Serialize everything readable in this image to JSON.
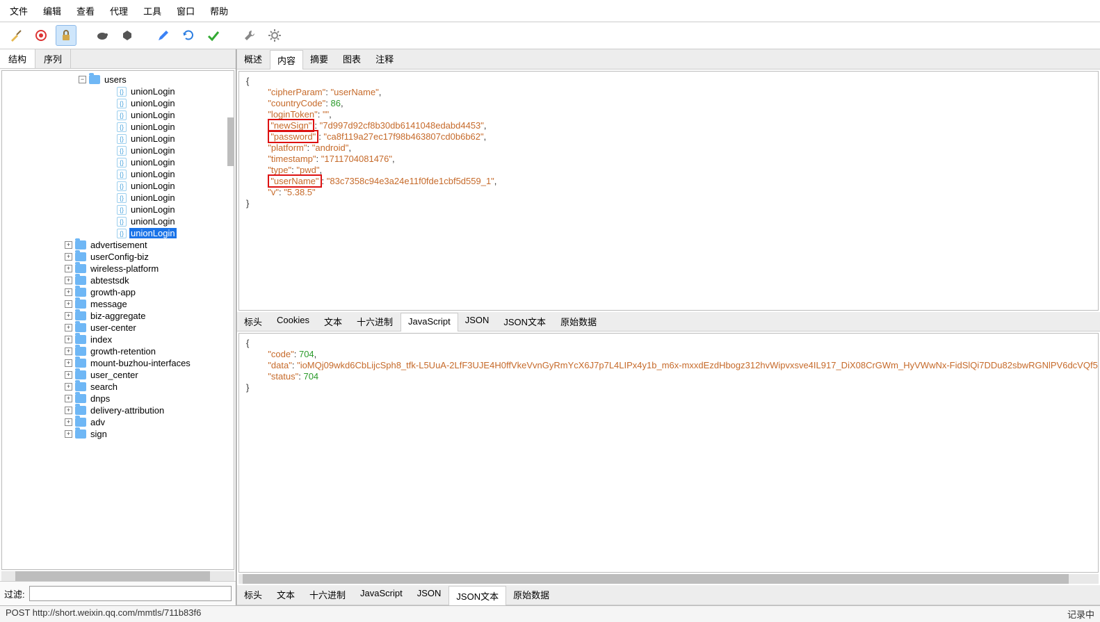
{
  "menu": {
    "items": [
      "文件",
      "编辑",
      "查看",
      "代理",
      "工具",
      "窗口",
      "帮助"
    ]
  },
  "toolbar": {
    "icons": [
      "broom",
      "record",
      "lock",
      "turtle-dark",
      "hex",
      "pen",
      "refresh",
      "check",
      "wrench",
      "gear"
    ],
    "selected_index": 2
  },
  "left_tabs": {
    "items": [
      "结构",
      "序列"
    ],
    "active": 0
  },
  "tree": {
    "root": {
      "name": "users",
      "expanded": true
    },
    "children": [
      {
        "name": "unionLogin",
        "selected": false
      },
      {
        "name": "unionLogin",
        "selected": false
      },
      {
        "name": "unionLogin",
        "selected": false
      },
      {
        "name": "unionLogin",
        "selected": false
      },
      {
        "name": "unionLogin",
        "selected": false
      },
      {
        "name": "unionLogin",
        "selected": false
      },
      {
        "name": "unionLogin",
        "selected": false
      },
      {
        "name": "unionLogin",
        "selected": false
      },
      {
        "name": "unionLogin",
        "selected": false
      },
      {
        "name": "unionLogin",
        "selected": false
      },
      {
        "name": "unionLogin",
        "selected": false
      },
      {
        "name": "unionLogin",
        "selected": false
      },
      {
        "name": "unionLogin",
        "selected": true
      }
    ],
    "siblings": [
      "advertisement",
      "userConfig-biz",
      "wireless-platform",
      "abtestsdk",
      "growth-app",
      "message",
      "biz-aggregate",
      "user-center",
      "index",
      "growth-retention",
      "mount-buzhou-interfaces",
      "user_center",
      "search",
      "dnps",
      "delivery-attribution",
      "adv",
      "sign"
    ]
  },
  "filter": {
    "label": "过滤:",
    "value": ""
  },
  "top_tabs": {
    "items": [
      "概述",
      "内容",
      "摘要",
      "图表",
      "注释"
    ],
    "active": 1
  },
  "req_json": {
    "open": "{",
    "lines": [
      {
        "key": "cipherParam",
        "val": "\"userName\"",
        "type": "s"
      },
      {
        "key": "countryCode",
        "val": "86",
        "type": "n"
      },
      {
        "key": "loginToken",
        "val": "\"\"",
        "type": "s"
      },
      {
        "key": "newSign",
        "val": "\"7d997d92cf8b30db6141048edabd4453\"",
        "type": "s",
        "boxed": true
      },
      {
        "key": "password",
        "val": "\"ca8f119a27ec17f98b463807cd0b6b62\"",
        "type": "s",
        "boxed": true
      },
      {
        "key": "platform",
        "val": "\"android\"",
        "type": "s"
      },
      {
        "key": "timestamp",
        "val": "\"1711704081476\"",
        "type": "s"
      },
      {
        "key": "type",
        "val": "\"pwd\"",
        "type": "s"
      },
      {
        "key": "userName",
        "val": "\"83c7358c94e3a24e11f0fde1cbf5d559_1\"",
        "type": "s",
        "boxed": true
      },
      {
        "key": "v",
        "val": "\"5.38.5\"",
        "type": "s",
        "last": true
      }
    ],
    "close": "}"
  },
  "mid_tabs": {
    "items": [
      "标头",
      "Cookies",
      "文本",
      "十六进制",
      "JavaScript",
      "JSON",
      "JSON文本",
      "原始数据"
    ],
    "active": 4
  },
  "resp_json": {
    "open": "{",
    "lines": [
      {
        "key": "code",
        "val": "704",
        "type": "n"
      },
      {
        "key": "data",
        "val": "\"ioMQj09wkd6CbLijcSph8_tfk-L5UuA-2LfF3UJE4H0ffVkeVvnGyRmYcX6J7p7L4LIPx4y1b_m6x-mxxdEzdHbogz312hvWipvxsve4IL917_DiX08CrGWm_HyVWwNx-FidSlQi7DDu82sbwRGNlPV6dcVQf5\"",
        "type": "s"
      },
      {
        "key": "status",
        "val": "704",
        "type": "n",
        "last": true
      }
    ],
    "close": "}"
  },
  "bot_tabs": {
    "items": [
      "标头",
      "文本",
      "十六进制",
      "JavaScript",
      "JSON",
      "JSON文本",
      "原始数据"
    ],
    "active": 5
  },
  "status": {
    "left": "POST http://short.weixin.qq.com/mmtls/711b83f6",
    "right": "记录中"
  }
}
